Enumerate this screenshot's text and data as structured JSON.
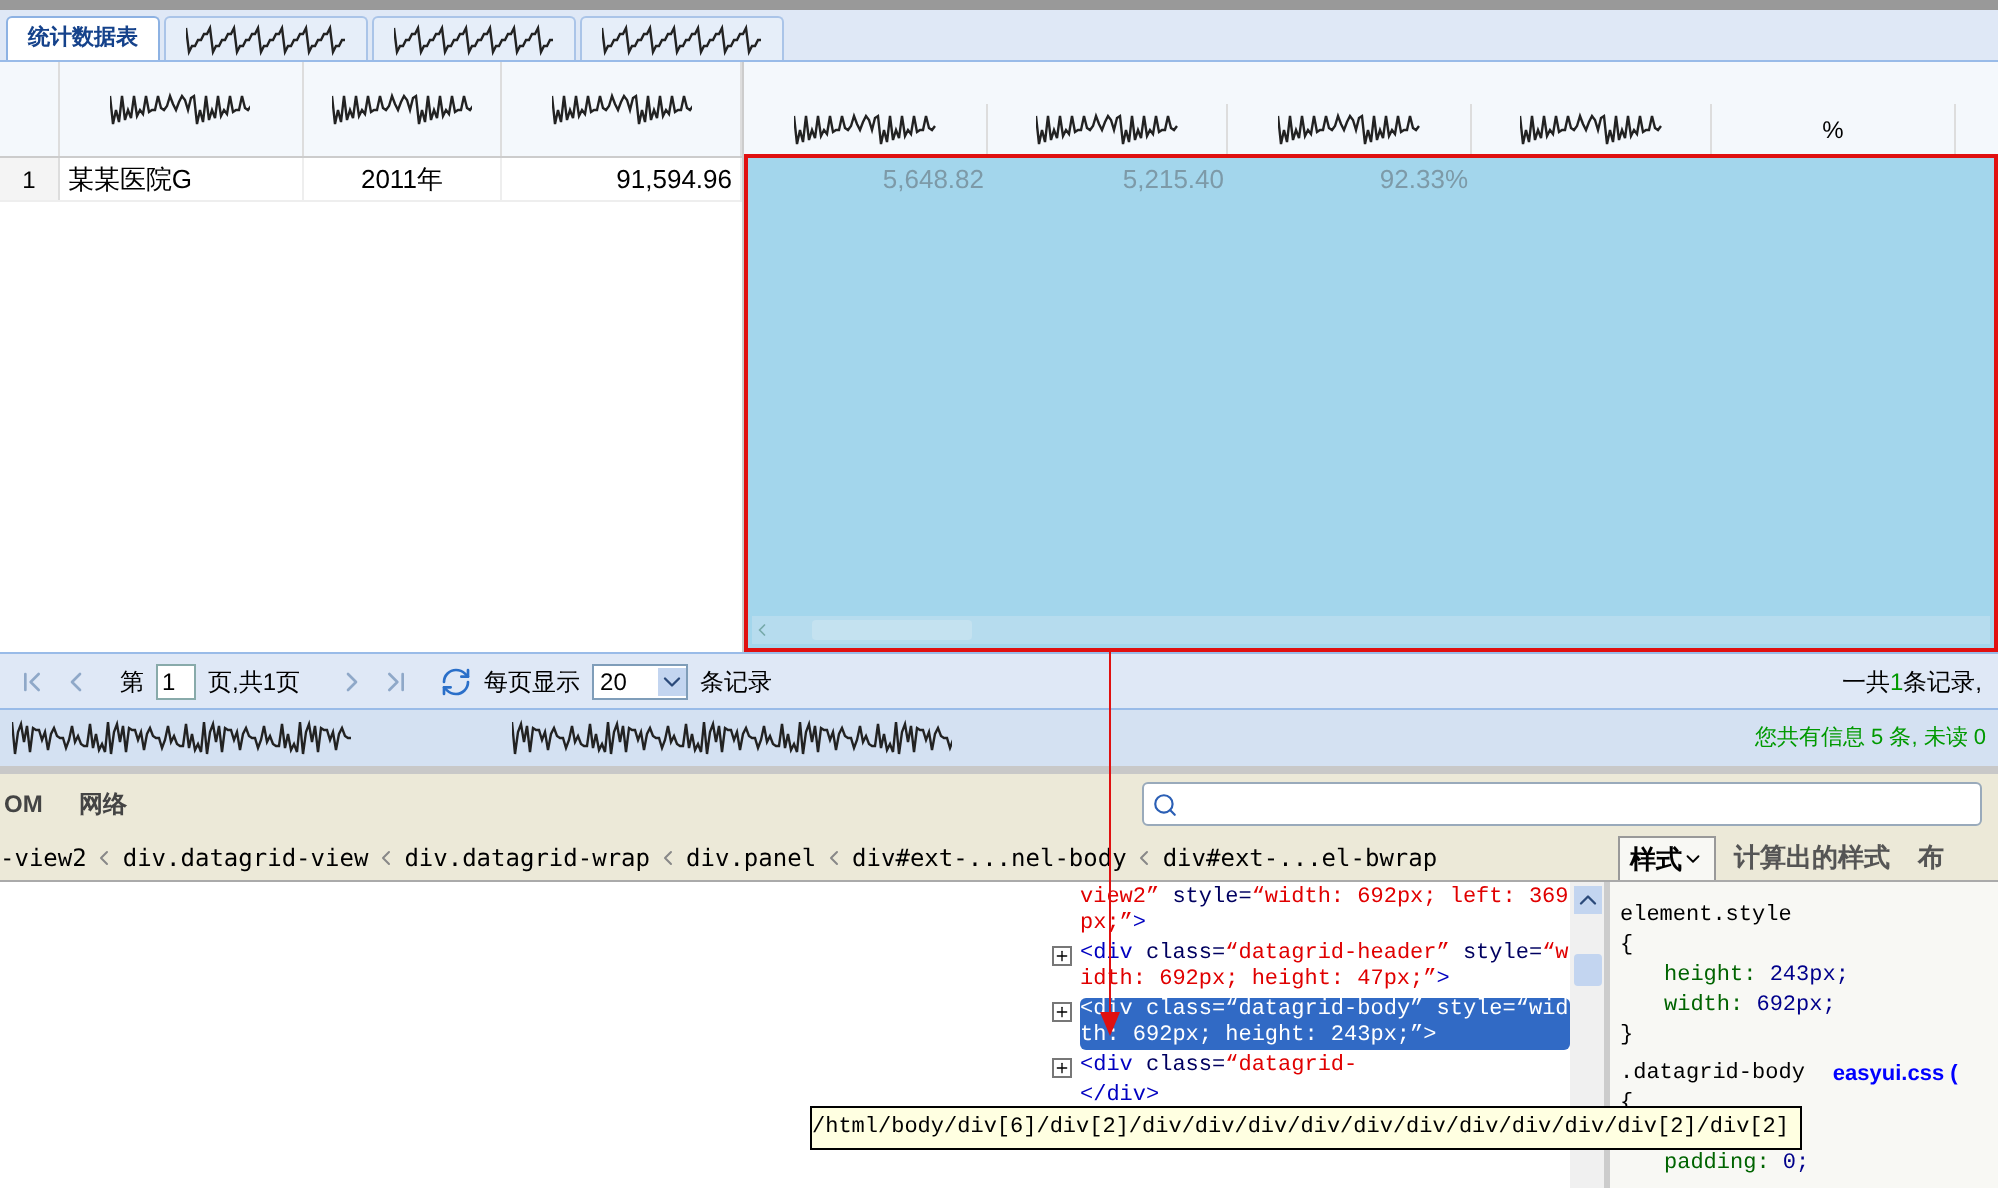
{
  "tabs": [
    {
      "kind": "text",
      "label": "统计数据表",
      "selected": true
    },
    {
      "kind": "scribbled",
      "selected": false
    },
    {
      "kind": "scribbled",
      "selected": false
    },
    {
      "kind": "scribbled",
      "selected": false
    }
  ],
  "grid": {
    "left_header": [
      {
        "kind": "blank"
      },
      {
        "kind": "scribbled"
      },
      {
        "kind": "scribbled"
      },
      {
        "kind": "scribbled"
      }
    ],
    "right_header": [
      {
        "kind": "scribbled"
      },
      {
        "kind": "scribbled"
      },
      {
        "kind": "scribbled"
      },
      {
        "kind": "scribbled"
      },
      {
        "kind": "text",
        "label": "%"
      }
    ],
    "rows": [
      {
        "number": "1",
        "left_cells": [
          "某某医院G",
          "2011年",
          "91,594.96"
        ],
        "right_cells": [
          "5,648.82",
          "5,215.40",
          "92.33%"
        ]
      }
    ],
    "highlighted": true
  },
  "pager": {
    "page_prefix": "第",
    "page_value": "1",
    "page_suffix": "页,共1页",
    "page_size_label": "每页显示",
    "page_size": "20",
    "records_label": "条记录",
    "summary_prefix": "一共",
    "summary_count": "1",
    "summary_suffix": "条记录,"
  },
  "status_bar": {
    "left": [
      {
        "kind": "scribbled"
      },
      {
        "kind": "scribbled"
      }
    ],
    "message": "您共有信息 5 条, 未读 0"
  },
  "devtools": {
    "tabs": [
      {
        "label": "OM",
        "selected": false
      },
      {
        "label": "网络",
        "selected": false
      }
    ],
    "breadcrumbs": [
      "-view2",
      "div.datagrid-view",
      "div.datagrid-wrap",
      "div.panel",
      "div#ext-...nel-body",
      "div#ext-...el-bwrap"
    ],
    "side_tabs": [
      {
        "label": "样式",
        "selected": true
      },
      {
        "label": "计算出的样式",
        "selected": false
      },
      {
        "label": "布",
        "selected": false
      }
    ],
    "html_tree": [
      {
        "expandable": false,
        "selected": false,
        "segments": [
          {
            "kind": "value",
            "text": "view2”"
          },
          {
            "kind": "attr",
            "text": " style="
          },
          {
            "kind": "value",
            "text": "“width: 692px; left: 369px;”"
          },
          {
            "kind": "tag",
            "text": ">"
          }
        ]
      },
      {
        "expandable": true,
        "selected": false,
        "segments": [
          {
            "kind": "tag",
            "text": "<div"
          },
          {
            "kind": "attr",
            "text": " class="
          },
          {
            "kind": "value",
            "text": "“datagrid-header”"
          },
          {
            "kind": "attr",
            "text": " style="
          },
          {
            "kind": "value",
            "text": "“width: 692px; height: 47px;”"
          },
          {
            "kind": "tag",
            "text": ">"
          }
        ]
      },
      {
        "expandable": true,
        "selected": true,
        "segments": [
          {
            "kind": "tag",
            "text": "<div"
          },
          {
            "kind": "attr",
            "text": " class="
          },
          {
            "kind": "value",
            "text": "“datagrid-body”"
          },
          {
            "kind": "attr",
            "text": " style="
          },
          {
            "kind": "value",
            "text": "“width: 692px; height: 243px;”"
          },
          {
            "kind": "tag",
            "text": ">"
          }
        ]
      },
      {
        "expandable": true,
        "selected": false,
        "segments": [
          {
            "kind": "tag",
            "text": "<div"
          },
          {
            "kind": "attr",
            "text": " class="
          },
          {
            "kind": "value",
            "text": "“datagrid-"
          }
        ]
      },
      {
        "expandable": false,
        "selected": false,
        "segments": [
          {
            "kind": "tag",
            "text": "</div>"
          }
        ]
      }
    ],
    "styles": [
      {
        "kind": "selector",
        "text": "element.style"
      },
      {
        "kind": "brace",
        "text": "{"
      },
      {
        "kind": "property",
        "name": "height:",
        "value": "243px;"
      },
      {
        "kind": "property",
        "name": "width:",
        "value": "692px;"
      },
      {
        "kind": "brace",
        "text": "}"
      },
      {
        "kind": "selector",
        "text": ".datagrid-body",
        "source": "easyui.css ("
      },
      {
        "kind": "brace",
        "text": "{"
      },
      {
        "kind": "gap"
      },
      {
        "kind": "property",
        "name": "padding:",
        "value": "0;"
      }
    ],
    "tooltip": "/html/body/div[6]/div[2]/div/div/div/div/div/div/div/div/div/div[2]/div[2]"
  }
}
